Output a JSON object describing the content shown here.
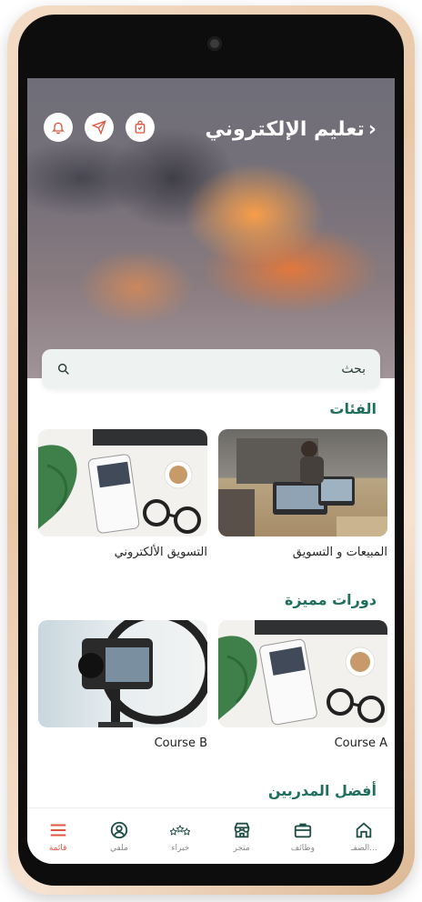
{
  "header": {
    "title": "تعليم الإلكتروني"
  },
  "search": {
    "placeholder": "بحث"
  },
  "sections": {
    "categories": {
      "title": "الفئات",
      "items": [
        {
          "label": "المبيعات و التسويق"
        },
        {
          "label": "التسويق الألكتروني"
        }
      ]
    },
    "featured": {
      "title": "دورات مميزة",
      "items": [
        {
          "label": "Course A"
        },
        {
          "label": "Course B"
        }
      ]
    },
    "trainers": {
      "title": "أفضل المدربين"
    }
  },
  "nav": {
    "items": [
      {
        "label": "الصفـ...",
        "icon": "home-icon"
      },
      {
        "label": "وظائف",
        "icon": "briefcase-icon"
      },
      {
        "label": "متجر",
        "icon": "store-icon"
      },
      {
        "label": "خبراء",
        "icon": "stars-icon"
      },
      {
        "label": "ملفي",
        "icon": "profile-icon"
      },
      {
        "label": "قائمة",
        "icon": "menu-icon"
      }
    ]
  },
  "colors": {
    "accent": "#1f6e5e",
    "active": "#e0553e"
  }
}
